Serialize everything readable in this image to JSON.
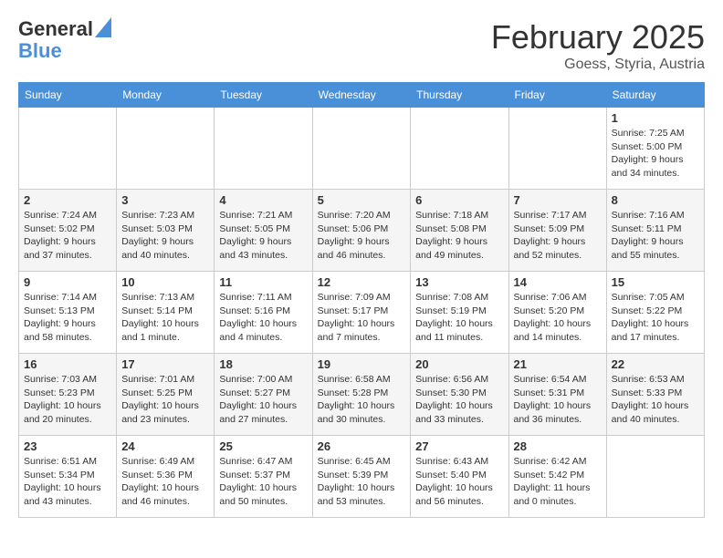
{
  "header": {
    "logo_line1": "General",
    "logo_line2": "Blue",
    "month_title": "February 2025",
    "location": "Goess, Styria, Austria"
  },
  "days_of_week": [
    "Sunday",
    "Monday",
    "Tuesday",
    "Wednesday",
    "Thursday",
    "Friday",
    "Saturday"
  ],
  "weeks": [
    [
      {
        "day": "",
        "info": ""
      },
      {
        "day": "",
        "info": ""
      },
      {
        "day": "",
        "info": ""
      },
      {
        "day": "",
        "info": ""
      },
      {
        "day": "",
        "info": ""
      },
      {
        "day": "",
        "info": ""
      },
      {
        "day": "1",
        "info": "Sunrise: 7:25 AM\nSunset: 5:00 PM\nDaylight: 9 hours and 34 minutes."
      }
    ],
    [
      {
        "day": "2",
        "info": "Sunrise: 7:24 AM\nSunset: 5:02 PM\nDaylight: 9 hours and 37 minutes."
      },
      {
        "day": "3",
        "info": "Sunrise: 7:23 AM\nSunset: 5:03 PM\nDaylight: 9 hours and 40 minutes."
      },
      {
        "day": "4",
        "info": "Sunrise: 7:21 AM\nSunset: 5:05 PM\nDaylight: 9 hours and 43 minutes."
      },
      {
        "day": "5",
        "info": "Sunrise: 7:20 AM\nSunset: 5:06 PM\nDaylight: 9 hours and 46 minutes."
      },
      {
        "day": "6",
        "info": "Sunrise: 7:18 AM\nSunset: 5:08 PM\nDaylight: 9 hours and 49 minutes."
      },
      {
        "day": "7",
        "info": "Sunrise: 7:17 AM\nSunset: 5:09 PM\nDaylight: 9 hours and 52 minutes."
      },
      {
        "day": "8",
        "info": "Sunrise: 7:16 AM\nSunset: 5:11 PM\nDaylight: 9 hours and 55 minutes."
      }
    ],
    [
      {
        "day": "9",
        "info": "Sunrise: 7:14 AM\nSunset: 5:13 PM\nDaylight: 9 hours and 58 minutes."
      },
      {
        "day": "10",
        "info": "Sunrise: 7:13 AM\nSunset: 5:14 PM\nDaylight: 10 hours and 1 minute."
      },
      {
        "day": "11",
        "info": "Sunrise: 7:11 AM\nSunset: 5:16 PM\nDaylight: 10 hours and 4 minutes."
      },
      {
        "day": "12",
        "info": "Sunrise: 7:09 AM\nSunset: 5:17 PM\nDaylight: 10 hours and 7 minutes."
      },
      {
        "day": "13",
        "info": "Sunrise: 7:08 AM\nSunset: 5:19 PM\nDaylight: 10 hours and 11 minutes."
      },
      {
        "day": "14",
        "info": "Sunrise: 7:06 AM\nSunset: 5:20 PM\nDaylight: 10 hours and 14 minutes."
      },
      {
        "day": "15",
        "info": "Sunrise: 7:05 AM\nSunset: 5:22 PM\nDaylight: 10 hours and 17 minutes."
      }
    ],
    [
      {
        "day": "16",
        "info": "Sunrise: 7:03 AM\nSunset: 5:23 PM\nDaylight: 10 hours and 20 minutes."
      },
      {
        "day": "17",
        "info": "Sunrise: 7:01 AM\nSunset: 5:25 PM\nDaylight: 10 hours and 23 minutes."
      },
      {
        "day": "18",
        "info": "Sunrise: 7:00 AM\nSunset: 5:27 PM\nDaylight: 10 hours and 27 minutes."
      },
      {
        "day": "19",
        "info": "Sunrise: 6:58 AM\nSunset: 5:28 PM\nDaylight: 10 hours and 30 minutes."
      },
      {
        "day": "20",
        "info": "Sunrise: 6:56 AM\nSunset: 5:30 PM\nDaylight: 10 hours and 33 minutes."
      },
      {
        "day": "21",
        "info": "Sunrise: 6:54 AM\nSunset: 5:31 PM\nDaylight: 10 hours and 36 minutes."
      },
      {
        "day": "22",
        "info": "Sunrise: 6:53 AM\nSunset: 5:33 PM\nDaylight: 10 hours and 40 minutes."
      }
    ],
    [
      {
        "day": "23",
        "info": "Sunrise: 6:51 AM\nSunset: 5:34 PM\nDaylight: 10 hours and 43 minutes."
      },
      {
        "day": "24",
        "info": "Sunrise: 6:49 AM\nSunset: 5:36 PM\nDaylight: 10 hours and 46 minutes."
      },
      {
        "day": "25",
        "info": "Sunrise: 6:47 AM\nSunset: 5:37 PM\nDaylight: 10 hours and 50 minutes."
      },
      {
        "day": "26",
        "info": "Sunrise: 6:45 AM\nSunset: 5:39 PM\nDaylight: 10 hours and 53 minutes."
      },
      {
        "day": "27",
        "info": "Sunrise: 6:43 AM\nSunset: 5:40 PM\nDaylight: 10 hours and 56 minutes."
      },
      {
        "day": "28",
        "info": "Sunrise: 6:42 AM\nSunset: 5:42 PM\nDaylight: 11 hours and 0 minutes."
      },
      {
        "day": "",
        "info": ""
      }
    ]
  ]
}
